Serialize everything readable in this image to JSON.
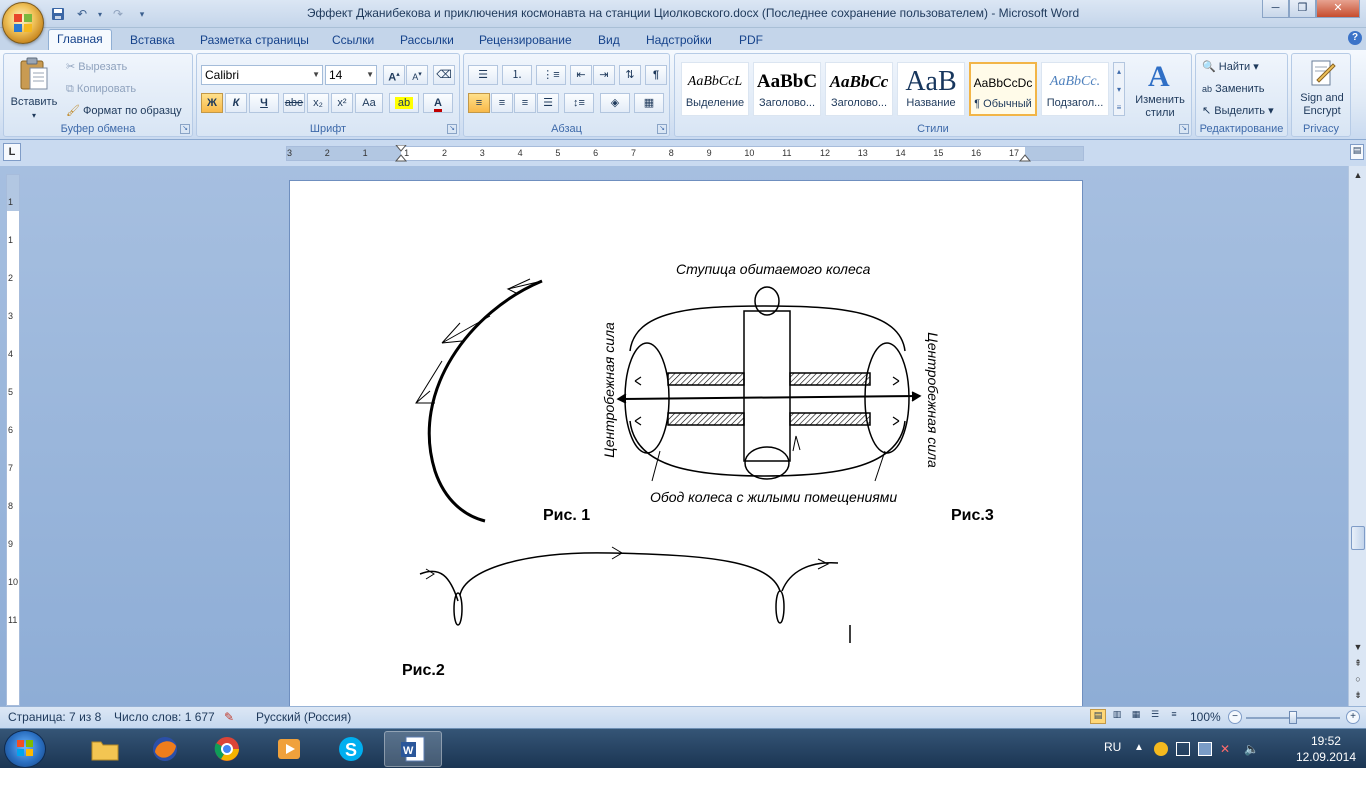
{
  "window": {
    "title": "Эффект Джанибекова  и приключения космонавта на станции Циолковского.docx (Последнее сохранение пользователем) - Microsoft Word"
  },
  "tabs": [
    "Главная",
    "Вставка",
    "Разметка страницы",
    "Ссылки",
    "Рассылки",
    "Рецензирование",
    "Вид",
    "Надстройки",
    "PDF"
  ],
  "ribbon": {
    "clipboard": {
      "paste": "Вставить",
      "cut": "Вырезать",
      "copy": "Копировать",
      "format_painter": "Формат по образцу",
      "label": "Буфер обмена"
    },
    "font": {
      "name": "Calibri",
      "size": "14",
      "label": "Шрифт",
      "bold": "Ж",
      "italic": "К",
      "underline": "Ч",
      "strike": "abe",
      "subscript": "x₂",
      "superscript": "x²",
      "change_case": "Aa",
      "grow": "A",
      "shrink": "A",
      "font_color": "A"
    },
    "paragraph": {
      "label": "Абзац"
    },
    "styles": {
      "items": [
        {
          "sample": "AaBbCcL",
          "name": "Выделение"
        },
        {
          "sample": "AaBbC",
          "name": "Заголово..."
        },
        {
          "sample": "AaBbCc",
          "name": "Заголово..."
        },
        {
          "sample": "AaB",
          "name": "Название"
        },
        {
          "sample": "AaBbCcDc",
          "name": "¶ Обычный"
        },
        {
          "sample": "AaBbCc.",
          "name": "Подзагол..."
        }
      ],
      "change_styles": "Изменить стили",
      "label": "Стили"
    },
    "editing": {
      "find": "Найти",
      "replace": "Заменить",
      "select": "Выделить",
      "label": "Редактирование"
    },
    "privacy": {
      "sign": "Sign and Encrypt",
      "label": "Privacy"
    }
  },
  "ruler": {
    "h_numbers": [
      "3",
      "2",
      "1",
      "1",
      "2",
      "3",
      "4",
      "5",
      "6",
      "7",
      "8",
      "9",
      "10",
      "11",
      "12",
      "13",
      "14",
      "15",
      "16",
      "17"
    ],
    "v_numbers": [
      "1",
      "1",
      "2",
      "3",
      "4",
      "5",
      "6",
      "7",
      "8",
      "9",
      "10",
      "11"
    ]
  },
  "document": {
    "fig1_caption": "Рис. 1",
    "fig2_caption": "Рис.2",
    "fig3_caption": "Рис.3",
    "fig3_hub_label": "Ступица обитаемого колеса",
    "fig3_rim_label": "Обод колеса с жилыми помещениями",
    "fig3_force_left": "Центробежная сила",
    "fig3_force_right": "Центробежная сила"
  },
  "statusbar": {
    "page": "Страница: 7 из 8",
    "words": "Число слов: 1 677",
    "language": "Русский (Россия)",
    "zoom": "100%"
  },
  "taskbar": {
    "lang": "RU",
    "time": "19:52",
    "date": "12.09.2014"
  },
  "colors": {
    "ribbon_bg": "#dfe9f5",
    "workspace_bg": "#9ab6dc",
    "taskbar_bg": "#24405f",
    "active_style_border": "#f2b547"
  }
}
